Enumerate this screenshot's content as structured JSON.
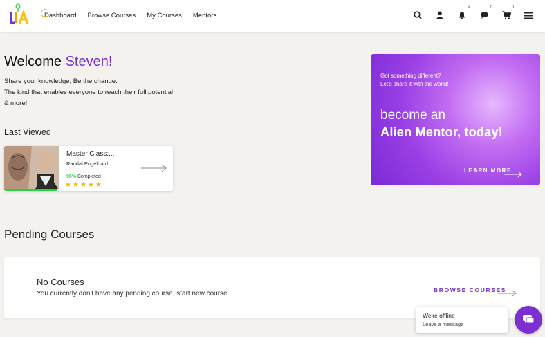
{
  "nav": {
    "items": [
      "Dashboard",
      "Browse Courses",
      "My Courses",
      "Mentors"
    ],
    "badges": {
      "notifications": "4",
      "messages": "0",
      "cart": "1"
    }
  },
  "welcome": {
    "greeting": "Welcome",
    "name": "Steven!",
    "intro": "Share your knowledge, Be the change.\nThe kind that enables everyone to reach their full potential & more!"
  },
  "last_viewed": {
    "title": "Last Viewed",
    "course": {
      "name": "Master Class:...",
      "author": "Randal Engelhard",
      "percent": "96%",
      "completed_label": "Completed",
      "progress_fraction": 0.96,
      "rating_stars": 5
    }
  },
  "banner": {
    "line_a": "Got something different?",
    "line_b": "Let's share it with the world!",
    "headline_1": "become an",
    "headline_2": "Alien Mentor, today!",
    "cta": "LEARN MORE"
  },
  "pending": {
    "title": "Pending Courses",
    "empty_title": "No Courses",
    "empty_text": "You currently don't have any pending course, start new course",
    "cta": "BROWSE COURSES"
  },
  "chat": {
    "status": "We're offline",
    "action": "Leave a message"
  },
  "colors": {
    "accent": "#7b2fd1",
    "progress": "#2ecc40",
    "star": "#f5b800",
    "background": "#f4f2ef"
  }
}
